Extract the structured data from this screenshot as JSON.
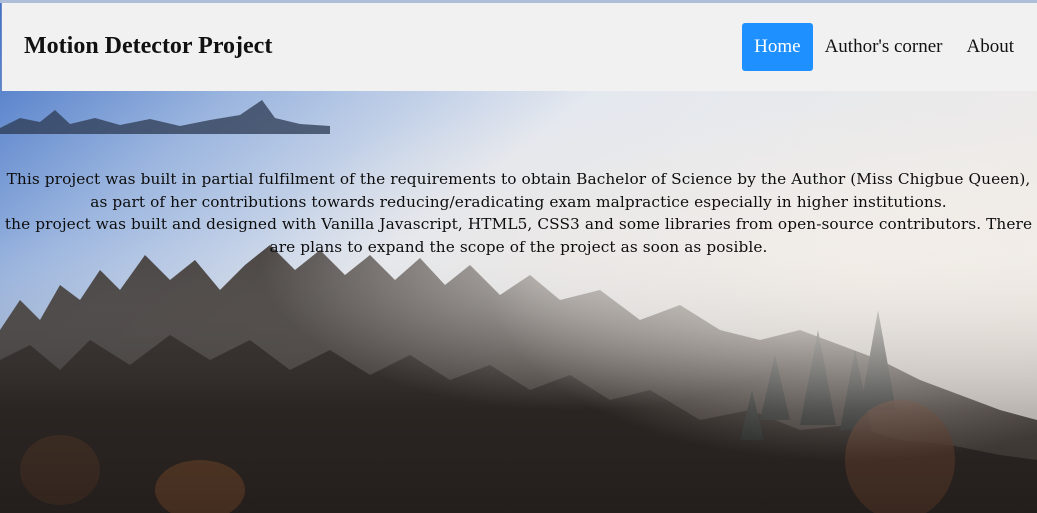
{
  "header": {
    "brand": "Motion Detector Project"
  },
  "nav": {
    "items": [
      {
        "label": "Home",
        "active": true
      },
      {
        "label": "Author's corner",
        "active": false
      },
      {
        "label": "About",
        "active": false
      }
    ]
  },
  "intro": {
    "paragraph1": "This project was built in partial fulfilment of the requirements to obtain Bachelor of Science by the Author (Miss Chigbue Queen), as part of her contributions towards reducing/eradicating exam malpractice especially in higher institutions.",
    "paragraph2": "the project was built and designed with Vanilla Javascript, HTML5, CSS3 and some libraries from open-source contributors. There are plans to expand the scope of the project as soon as posible."
  },
  "colors": {
    "nav_active": "#1e90ff",
    "navbar_bg": "#f1f1f1"
  }
}
